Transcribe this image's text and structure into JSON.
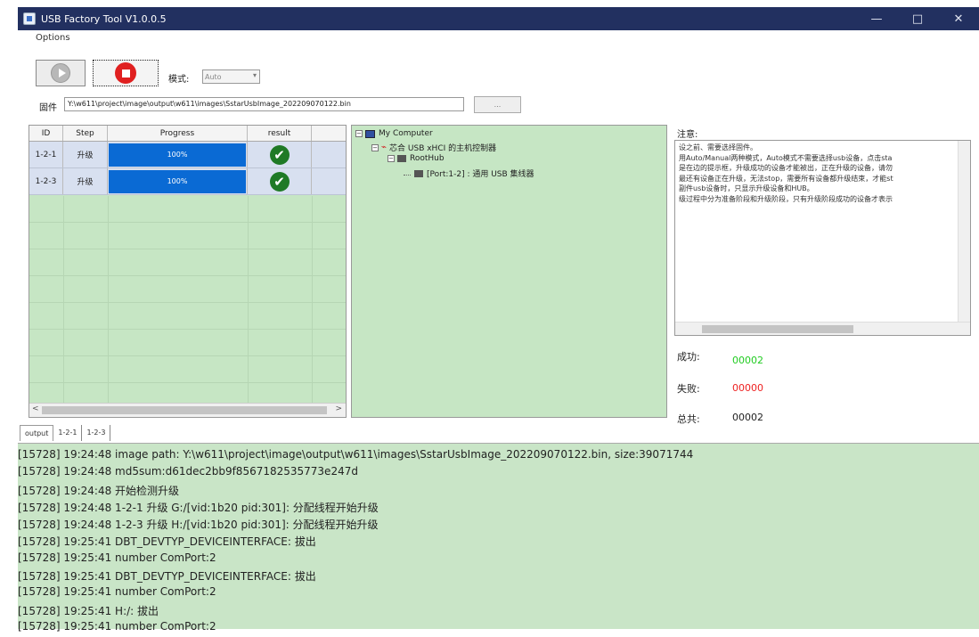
{
  "window": {
    "title": "USB Factory Tool V1.0.0.5",
    "min_glyph": "—",
    "max_glyph": "□",
    "close_glyph": "✕"
  },
  "menu": {
    "options": "Options"
  },
  "toolbar": {
    "mode_label": "模式:",
    "mode_value": "Auto",
    "firmware_label": "固件",
    "firmware_path": "Y:\\w611\\project\\image\\output\\w611\\images\\SstarUsbImage_202209070122.bin",
    "browse_label": "..."
  },
  "grid": {
    "columns": [
      "ID",
      "Step",
      "Progress",
      "result"
    ],
    "rows": [
      {
        "id": "1-2-1",
        "step": "升级",
        "progress": "100%",
        "result": "✔"
      },
      {
        "id": "1-2-3",
        "step": "升级",
        "progress": "100%",
        "result": "✔"
      }
    ],
    "scroll_left": "<",
    "scroll_right": ">"
  },
  "tree": {
    "root": "My Computer",
    "controller": "芯合 USB xHCI 的主机控制器",
    "roothub": "RootHub",
    "port": "[Port:1-2] : 通用 USB 集线器"
  },
  "notes": {
    "title": "注意:",
    "lines": [
      "设之前、需要选择固件。",
      "用Auto/Manual两种模式，Auto模式不需要选择usb设备，点击sta",
      "是在边的提示框，升级成功的设备才能被出，正在升级的设备，请勿",
      "最还有设备正在升级，无法stop，需要所有设备都升级结束，才能st",
      "副件usb设备时，只显示升级设备和HUB。",
      "级过程中分为准备阶段和升级阶段，只有升级阶段成功的设备才表示"
    ]
  },
  "stats": {
    "success_label": "成功:",
    "success_value": "00002",
    "fail_label": "失败:",
    "fail_value": "00000",
    "total_label": "总共:",
    "total_value": "00002"
  },
  "tabs": [
    "output",
    "1-2-1",
    "1-2-3"
  ],
  "log": [
    "[15728] 19:24:48  image path: Y:\\w611\\project\\image\\output\\w611\\images\\SstarUsbImage_202209070122.bin, size:39071744",
    "[15728] 19:24:48  md5sum:d61dec2bb9f8567182535773e247d",
    "[15728] 19:24:48  开始检测升级",
    "[15728] 19:24:48  1-2-1  升级 G:/[vid:1b20  pid:301]: 分配线程开始升级",
    "[15728] 19:24:48  1-2-3  升级 H:/[vid:1b20  pid:301]: 分配线程开始升级",
    "[15728] 19:25:41  DBT_DEVTYP_DEVICEINTERFACE: 拔出",
    "[15728] 19:25:41  number ComPort:2",
    "[15728] 19:25:41  DBT_DEVTYP_DEVICEINTERFACE: 拔出",
    "[15728] 19:25:41  number ComPort:2",
    "[15728] 19:25:41  H:/: 拔出",
    "[15728] 19:25:41  number ComPort:2"
  ],
  "colors": {
    "title_bar": "#223060",
    "panel_green": "#c6e6c4",
    "progress_blue": "#0a6ad4",
    "success_green": "#22cc22",
    "fail_red": "#ee2222",
    "stop_red": "#e02020"
  },
  "icons": [
    "app-icon",
    "play-icon",
    "stop-icon",
    "check-icon",
    "computer-icon",
    "usb-icon",
    "hub-icon"
  ]
}
